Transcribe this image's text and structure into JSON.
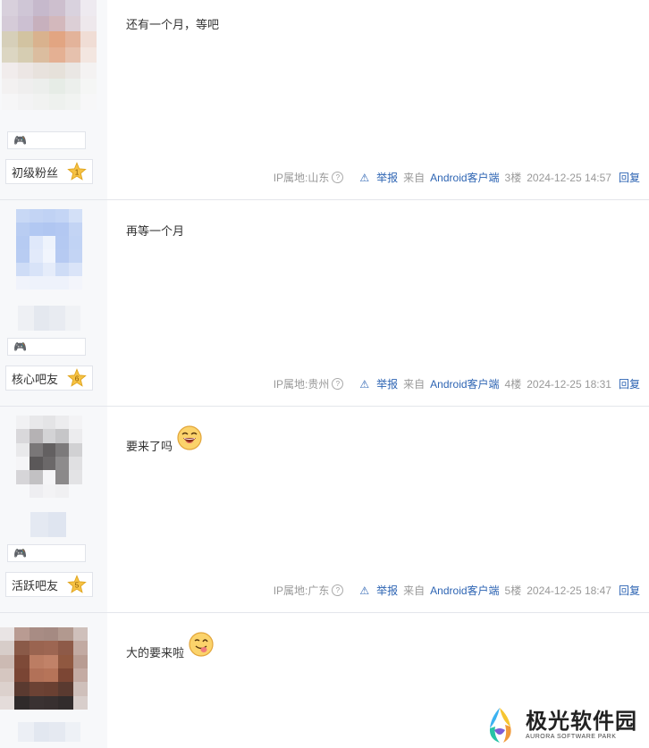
{
  "posts": [
    {
      "content": "还有一个月，等吧",
      "level_label": "初级粉丝",
      "level_number": "1",
      "ip_location": "IP属地:山东",
      "report": "举报",
      "source": "来自Android客户端",
      "floor": "3楼",
      "time": "2024-12-25 14:57",
      "reply": "回复",
      "has_emoji": false
    },
    {
      "content": "再等一个月",
      "level_label": "核心吧友",
      "level_number": "6",
      "ip_location": "IP属地:贵州",
      "report": "举报",
      "source": "来自Android客户端",
      "floor": "4楼",
      "time": "2024-12-25 18:31",
      "reply": "回复",
      "has_emoji": false
    },
    {
      "content": "要来了吗",
      "level_label": "活跃吧友",
      "level_number": "5",
      "ip_location": "IP属地:广东",
      "report": "举报",
      "source": "来自Android客户端",
      "floor": "5楼",
      "time": "2024-12-25 18:47",
      "reply": "回复",
      "has_emoji": true,
      "emoji": "laughing-face"
    },
    {
      "content": "大的要来啦",
      "has_emoji": true,
      "emoji": "tongue-face"
    }
  ],
  "watermark": {
    "title": "极光软件园",
    "subtitle": "AURORA SOFTWARE PARK"
  },
  "colors": {
    "link_blue": "#2d64b3",
    "meta_gray": "#999999",
    "sidebar_bg": "#f7f8fa",
    "star_gold": "#f6c244"
  }
}
